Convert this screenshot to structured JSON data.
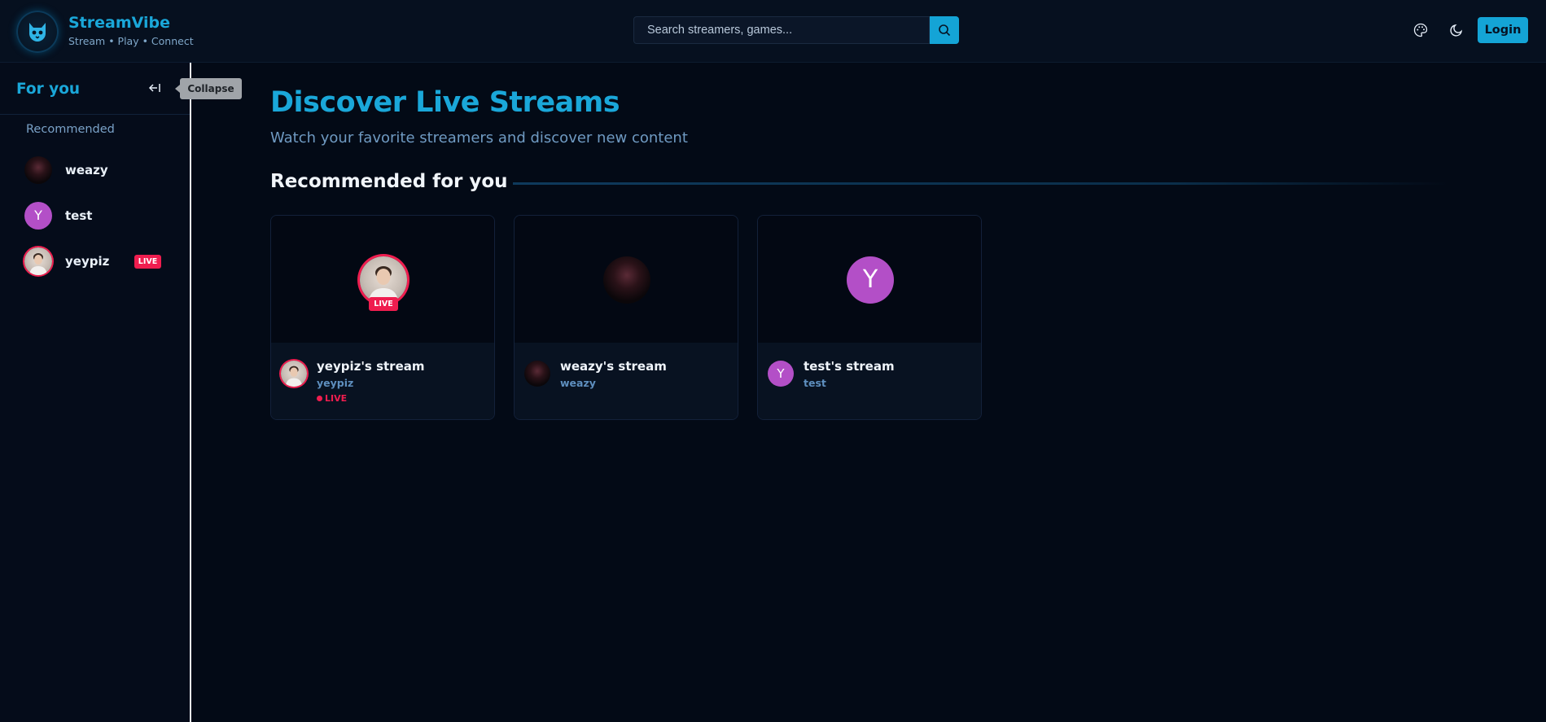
{
  "header": {
    "brand_name": "StreamVibe",
    "brand_tagline": "Stream • Play • Connect",
    "search_placeholder": "Search streamers, games...",
    "login_label": "Login",
    "icons": [
      "cat-logo-icon",
      "search-icon",
      "palette-icon",
      "moon-icon"
    ]
  },
  "sidebar": {
    "title": "For you",
    "collapse_tooltip": "Collapse",
    "section_label": "Recommended",
    "items": [
      {
        "name": "weazy",
        "avatar_letter": "",
        "live": false
      },
      {
        "name": "test",
        "avatar_letter": "Y",
        "live": false
      },
      {
        "name": "yeypiz",
        "avatar_letter": "",
        "live": true,
        "live_label": "LIVE"
      }
    ]
  },
  "main": {
    "title": "Discover Live Streams",
    "subtitle": "Watch your favorite streamers and discover new content",
    "section_title": "Recommended for you",
    "cards": [
      {
        "title": "yeypiz's stream",
        "username": "yeypiz",
        "live": true,
        "live_badge": "LIVE",
        "live_text": "LIVE"
      },
      {
        "title": "weazy's stream",
        "username": "weazy",
        "live": false
      },
      {
        "title": "test's stream",
        "username": "test",
        "live": false,
        "avatar_letter": "Y"
      }
    ]
  },
  "colors": {
    "accent": "#1aa7d9",
    "live": "#ef1d4f",
    "background": "#030a16",
    "letter_avatar": "#b34fc7"
  }
}
